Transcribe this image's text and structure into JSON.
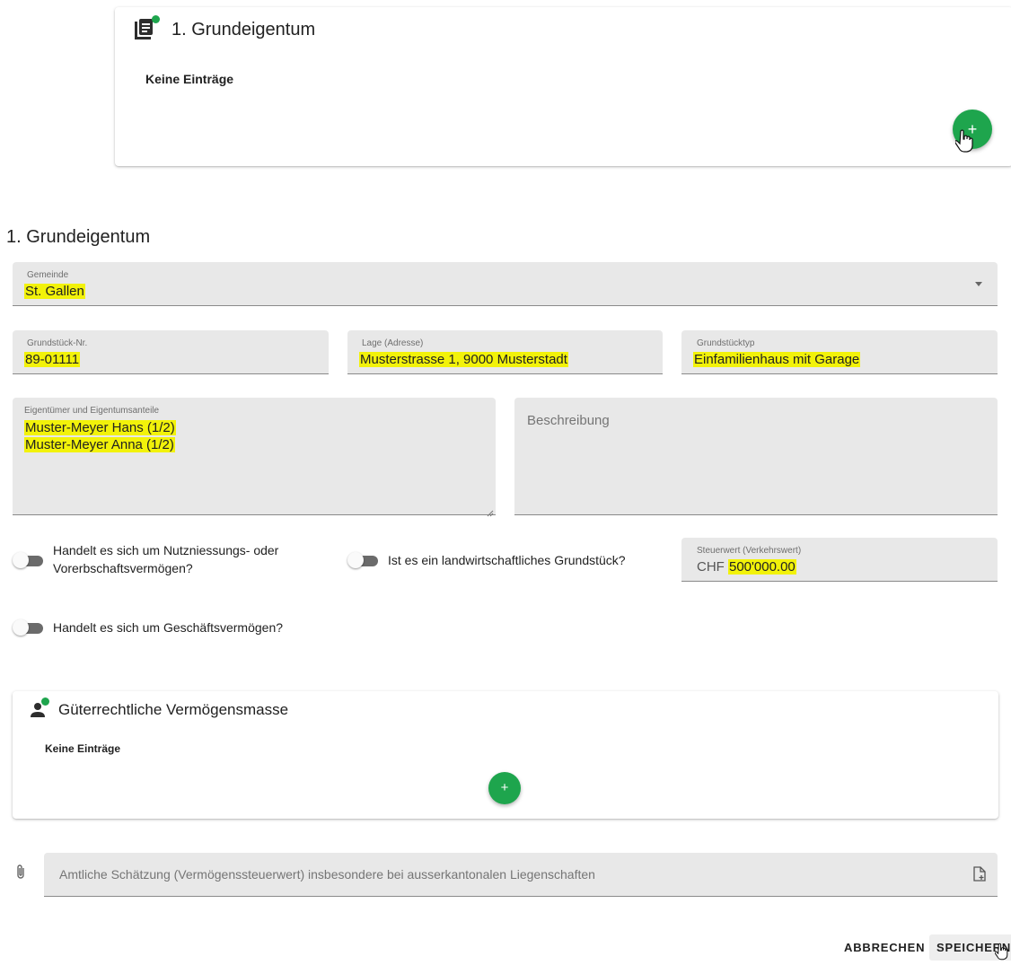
{
  "top_card": {
    "title": "1. Grundeigentum",
    "empty_text": "Keine Einträge",
    "icon": "document-list-icon",
    "add_label": "+"
  },
  "form": {
    "title": "1. Grundeigentum",
    "gemeinde": {
      "label": "Gemeinde",
      "value": "St. Gallen"
    },
    "grundstueck_nr": {
      "label": "Grundstück-Nr.",
      "value": "89-01111"
    },
    "lage": {
      "label": "Lage (Adresse)",
      "value": "Musterstrasse 1, 9000 Musterstadt"
    },
    "grundstuecktyp": {
      "label": "Grundstücktyp",
      "value": "Einfamilienhaus mit Garage"
    },
    "eigentuemer": {
      "label": "Eigentümer und Eigentumsanteile",
      "lines": [
        "Muster-Meyer Hans (1/2)",
        "Muster-Meyer Anna (1/2)"
      ]
    },
    "beschreibung": {
      "placeholder": "Beschreibung"
    },
    "toggle_nutzniessung": {
      "label_line1": "Handelt es sich um Nutzniessungs- oder",
      "label_line2": "Vorerbschaftsvermögen?",
      "on": false
    },
    "toggle_landwirtschaft": {
      "label": "Ist es ein landwirtschaftliches Grundstück?",
      "on": false
    },
    "steuerwert": {
      "label": "Steuerwert (Verkehrswert)",
      "prefix": "CHF",
      "value": "500'000.00"
    },
    "toggle_geschaeft": {
      "label": "Handelt es sich um Geschäftsvermögen?",
      "on": false
    }
  },
  "mass_card": {
    "title": "Güterrechtliche Vermögensmasse",
    "empty_text": "Keine Einträge",
    "icon": "person-icon",
    "add_label": "+"
  },
  "attachment": {
    "placeholder": "Amtliche Schätzung (Vermögenssteuerwert) insbesondere bei ausserkantonalen Liegenschaften",
    "icon": "paperclip-icon",
    "upload_icon": "file-add-icon"
  },
  "actions": {
    "cancel": "ABBRECHEN",
    "save": "SPEICHERN"
  },
  "colors": {
    "accent_green": "#1ea54d",
    "highlight": "#f2f20a",
    "field_bg": "#e8e8e8"
  }
}
